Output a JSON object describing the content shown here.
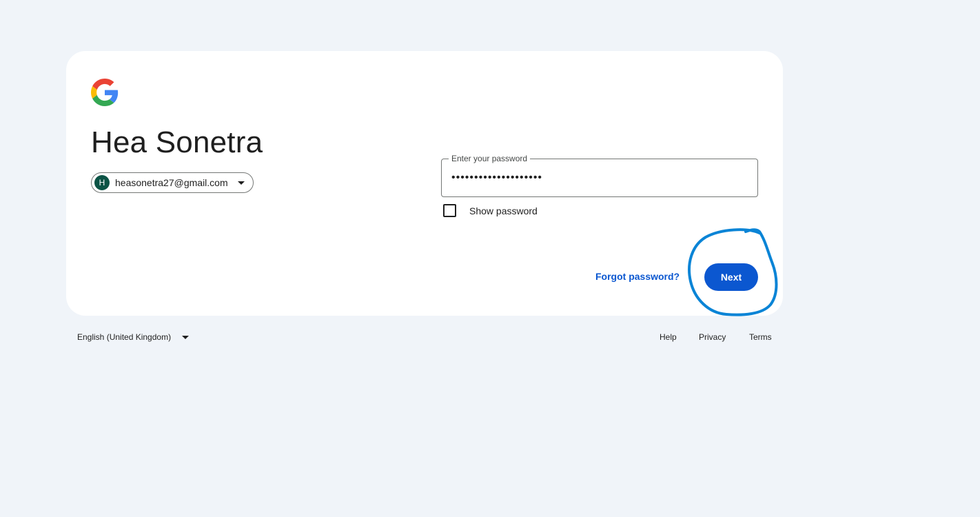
{
  "account": {
    "name": "Hea Sonetra",
    "email": "heasonetra27@gmail.com",
    "avatar_letter": "H"
  },
  "password": {
    "label": "Enter your password",
    "value": "••••••••••••••••••••"
  },
  "show_password_label": "Show password",
  "forgot_password_label": "Forgot password?",
  "next_label": "Next",
  "footer": {
    "language": "English (United Kingdom)",
    "help": "Help",
    "privacy": "Privacy",
    "terms": "Terms"
  },
  "colors": {
    "background": "#f0f4f9",
    "primary": "#0b57d0",
    "avatar": "#0b5345",
    "annotation": "#0a84d6"
  }
}
